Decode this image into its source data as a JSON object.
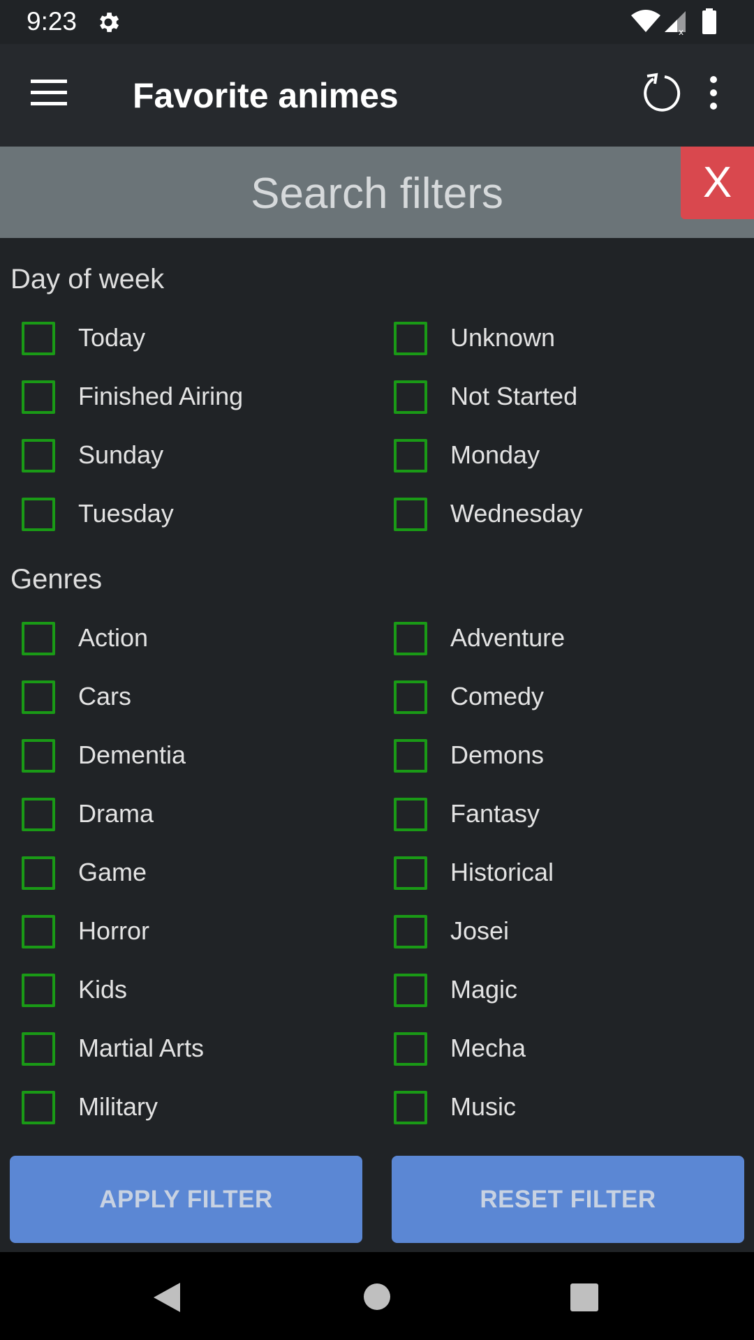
{
  "status_bar": {
    "time": "9:23"
  },
  "app_bar": {
    "title": "Favorite animes"
  },
  "filter_panel": {
    "title": "Search filters",
    "close_label": "X"
  },
  "sections": {
    "day_of_week": {
      "title": "Day of week",
      "left": [
        "Today",
        "Finished Airing",
        "Sunday",
        "Tuesday"
      ],
      "right": [
        "Unknown",
        "Not Started",
        "Monday",
        "Wednesday"
      ]
    },
    "genres": {
      "title": "Genres",
      "left": [
        "Action",
        "Cars",
        "Dementia",
        "Drama",
        "Game",
        "Horror",
        "Kids",
        "Martial Arts",
        "Military"
      ],
      "right": [
        "Adventure",
        "Comedy",
        "Demons",
        "Fantasy",
        "Historical",
        "Josei",
        "Magic",
        "Mecha",
        "Music"
      ]
    }
  },
  "buttons": {
    "apply": "APPLY FILTER",
    "reset": "RESET FILTER"
  },
  "colors": {
    "checkbox_border": "#1a9a16",
    "close_button": "#d9484e",
    "action_button": "#5b87d4"
  }
}
